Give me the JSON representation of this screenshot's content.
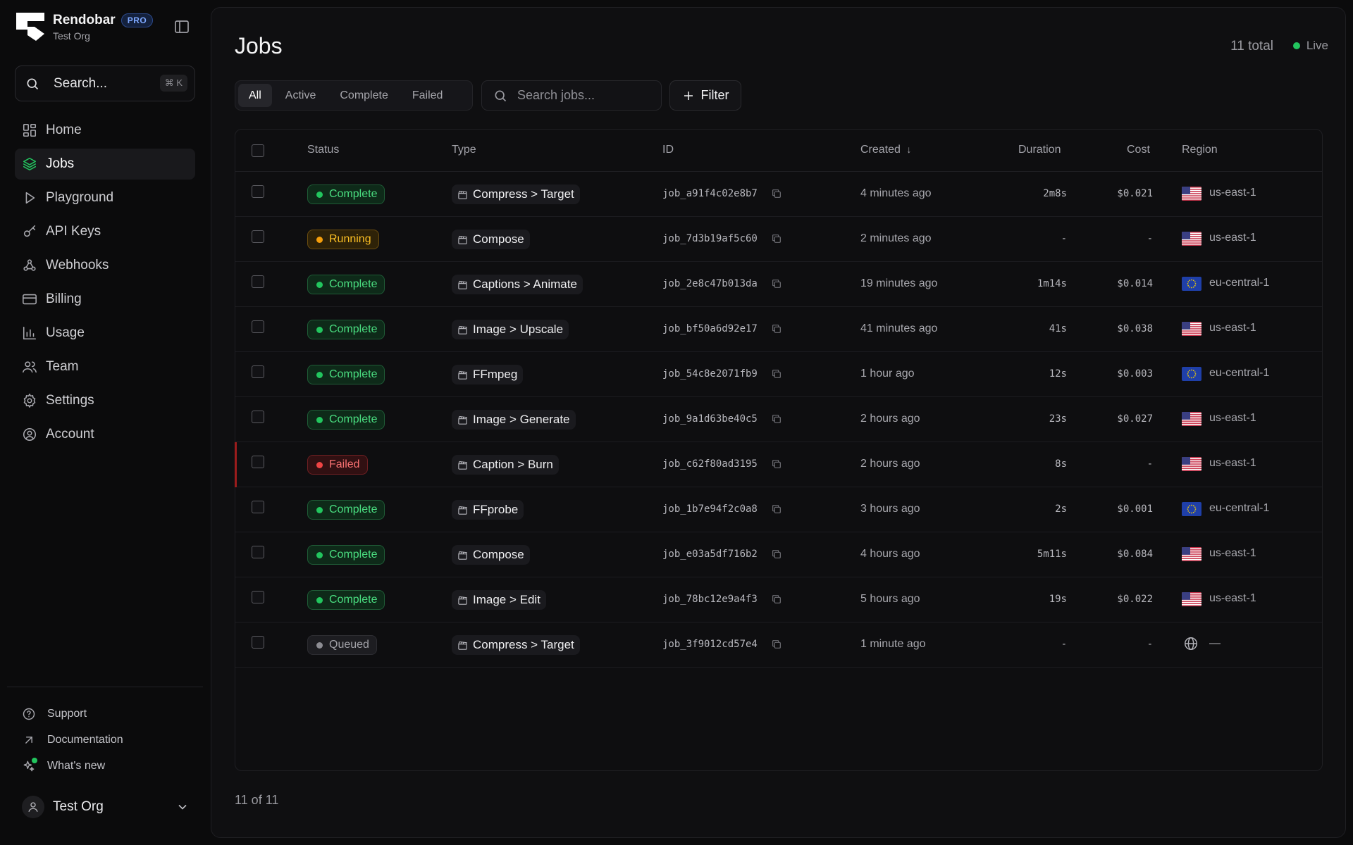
{
  "brand": {
    "name": "Rendobar",
    "badge": "PRO",
    "org": "Test Org"
  },
  "search": {
    "label": "Search...",
    "shortcut": "⌘ K"
  },
  "nav": [
    {
      "label": "Home",
      "icon": "home-icon",
      "active": false
    },
    {
      "label": "Jobs",
      "icon": "layers-icon",
      "active": true
    },
    {
      "label": "Playground",
      "icon": "play-icon",
      "active": false
    },
    {
      "label": "API Keys",
      "icon": "key-icon",
      "active": false
    },
    {
      "label": "Webhooks",
      "icon": "webhook-icon",
      "active": false
    },
    {
      "label": "Billing",
      "icon": "credit-card-icon",
      "active": false
    },
    {
      "label": "Usage",
      "icon": "bar-chart-icon",
      "active": false
    },
    {
      "label": "Team",
      "icon": "users-icon",
      "active": false
    },
    {
      "label": "Settings",
      "icon": "gear-icon",
      "active": false
    },
    {
      "label": "Account",
      "icon": "user-circle-icon",
      "active": false
    }
  ],
  "footer_links": [
    {
      "label": "Support",
      "icon": "help-circle-icon"
    },
    {
      "label": "Documentation",
      "icon": "arrow-up-right-icon"
    },
    {
      "label": "What's new",
      "icon": "sparkles-icon"
    }
  ],
  "org_switcher": {
    "name": "Test Org"
  },
  "page": {
    "title": "Jobs",
    "total": "11 total",
    "live": "Live"
  },
  "tabs": [
    {
      "label": "All",
      "active": true
    },
    {
      "label": "Active",
      "active": false
    },
    {
      "label": "Complete",
      "active": false
    },
    {
      "label": "Failed",
      "active": false
    }
  ],
  "job_search": {
    "placeholder": "Search jobs..."
  },
  "filter": {
    "label": "Filter"
  },
  "table": {
    "columns": {
      "status": "Status",
      "type": "Type",
      "id": "ID",
      "created": "Created",
      "duration": "Duration",
      "cost": "Cost",
      "region": "Region"
    },
    "sort_arrow": "↓",
    "rows": [
      {
        "status": "Complete",
        "type": "Compress > Target",
        "id": "job_a91f4c02e8b7",
        "created": "4 minutes ago",
        "duration": "2m8s",
        "cost": "$0.021",
        "region": "us-east-1",
        "flag": "us"
      },
      {
        "status": "Running",
        "type": "Compose",
        "id": "job_7d3b19af5c60",
        "created": "2 minutes ago",
        "duration": "-",
        "cost": "-",
        "region": "us-east-1",
        "flag": "us"
      },
      {
        "status": "Complete",
        "type": "Captions > Animate",
        "id": "job_2e8c47b013da",
        "created": "19 minutes ago",
        "duration": "1m14s",
        "cost": "$0.014",
        "region": "eu-central-1",
        "flag": "eu"
      },
      {
        "status": "Complete",
        "type": "Image > Upscale",
        "id": "job_bf50a6d92e17",
        "created": "41 minutes ago",
        "duration": "41s",
        "cost": "$0.038",
        "region": "us-east-1",
        "flag": "us"
      },
      {
        "status": "Complete",
        "type": "FFmpeg",
        "id": "job_54c8e2071fb9",
        "created": "1 hour ago",
        "duration": "12s",
        "cost": "$0.003",
        "region": "eu-central-1",
        "flag": "eu"
      },
      {
        "status": "Complete",
        "type": "Image > Generate",
        "id": "job_9a1d63be40c5",
        "created": "2 hours ago",
        "duration": "23s",
        "cost": "$0.027",
        "region": "us-east-1",
        "flag": "us"
      },
      {
        "status": "Failed",
        "type": "Caption > Burn",
        "id": "job_c62f80ad3195",
        "created": "2 hours ago",
        "duration": "8s",
        "cost": "-",
        "region": "us-east-1",
        "flag": "us"
      },
      {
        "status": "Complete",
        "type": "FFprobe",
        "id": "job_1b7e94f2c0a8",
        "created": "3 hours ago",
        "duration": "2s",
        "cost": "$0.001",
        "region": "eu-central-1",
        "flag": "eu"
      },
      {
        "status": "Complete",
        "type": "Compose",
        "id": "job_e03a5df716b2",
        "created": "4 hours ago",
        "duration": "5m11s",
        "cost": "$0.084",
        "region": "us-east-1",
        "flag": "us"
      },
      {
        "status": "Complete",
        "type": "Image > Edit",
        "id": "job_78bc12e9a4f3",
        "created": "5 hours ago",
        "duration": "19s",
        "cost": "$0.022",
        "region": "us-east-1",
        "flag": "us"
      },
      {
        "status": "Queued",
        "type": "Compress > Target",
        "id": "job_3f9012cd57e4",
        "created": "1 minute ago",
        "duration": "-",
        "cost": "-",
        "region": "—",
        "flag": "globe"
      }
    ]
  },
  "pagination": {
    "label": "11 of 11"
  },
  "colors": {
    "accent_green": "#22c55e",
    "running": "#f59e0b",
    "failed": "#ef4444",
    "queued": "#8d8d93",
    "pro_badge": "#7ea8ff"
  }
}
